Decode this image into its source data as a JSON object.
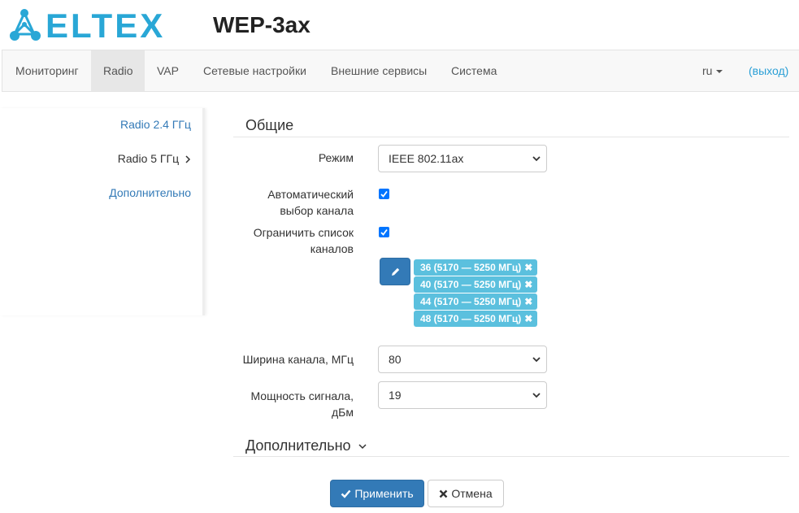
{
  "brand": {
    "logo_text": "ELTEX",
    "model": "WEP-3ax",
    "accent_color": "#29a7d6"
  },
  "nav": {
    "items": [
      "Мониторинг",
      "Radio",
      "VAP",
      "Сетевые настройки",
      "Внешние сервисы",
      "Система"
    ],
    "active": "Radio",
    "lang": "ru",
    "logout": "(выход)"
  },
  "sidebar": {
    "items": [
      {
        "label": "Radio 2.4 ГГц",
        "state": "link"
      },
      {
        "label": "Radio 5 ГГц",
        "state": "active",
        "icon": "chevron-right-icon"
      },
      {
        "label": "Дополнительно",
        "state": "link"
      }
    ]
  },
  "general": {
    "title": "Общие",
    "mode": {
      "label": "Режим",
      "value": "IEEE 802.11ax"
    },
    "auto_channel": {
      "label_line1": "Автоматический",
      "label_line2": "выбор канала",
      "checked": true
    },
    "limit_channels": {
      "label_line1": "Ограничить список",
      "label_line2": "каналов",
      "checked": true
    },
    "edit_icon": "pencil-icon",
    "channels": [
      "36 (5170 — 5250 МГц)",
      "40 (5170 — 5250 МГц)",
      "44 (5170 — 5250 МГц)",
      "48 (5170 — 5250 МГц)"
    ],
    "tag_remove_glyph": "✖",
    "width": {
      "label": "Ширина канала, МГц",
      "value": "80"
    },
    "power": {
      "label_line1": "Мощность сигнала,",
      "label_line2": "дБм",
      "value": "19"
    }
  },
  "advanced": {
    "title": "Дополнительно"
  },
  "actions": {
    "apply": "Применить",
    "cancel": "Отмена",
    "apply_icon": "check-icon",
    "cancel_icon": "close-icon"
  },
  "colors": {
    "primary": "#337ab7",
    "tag": "#5bc0de",
    "link": "#337ab7",
    "checkbox": "#0075ff"
  }
}
